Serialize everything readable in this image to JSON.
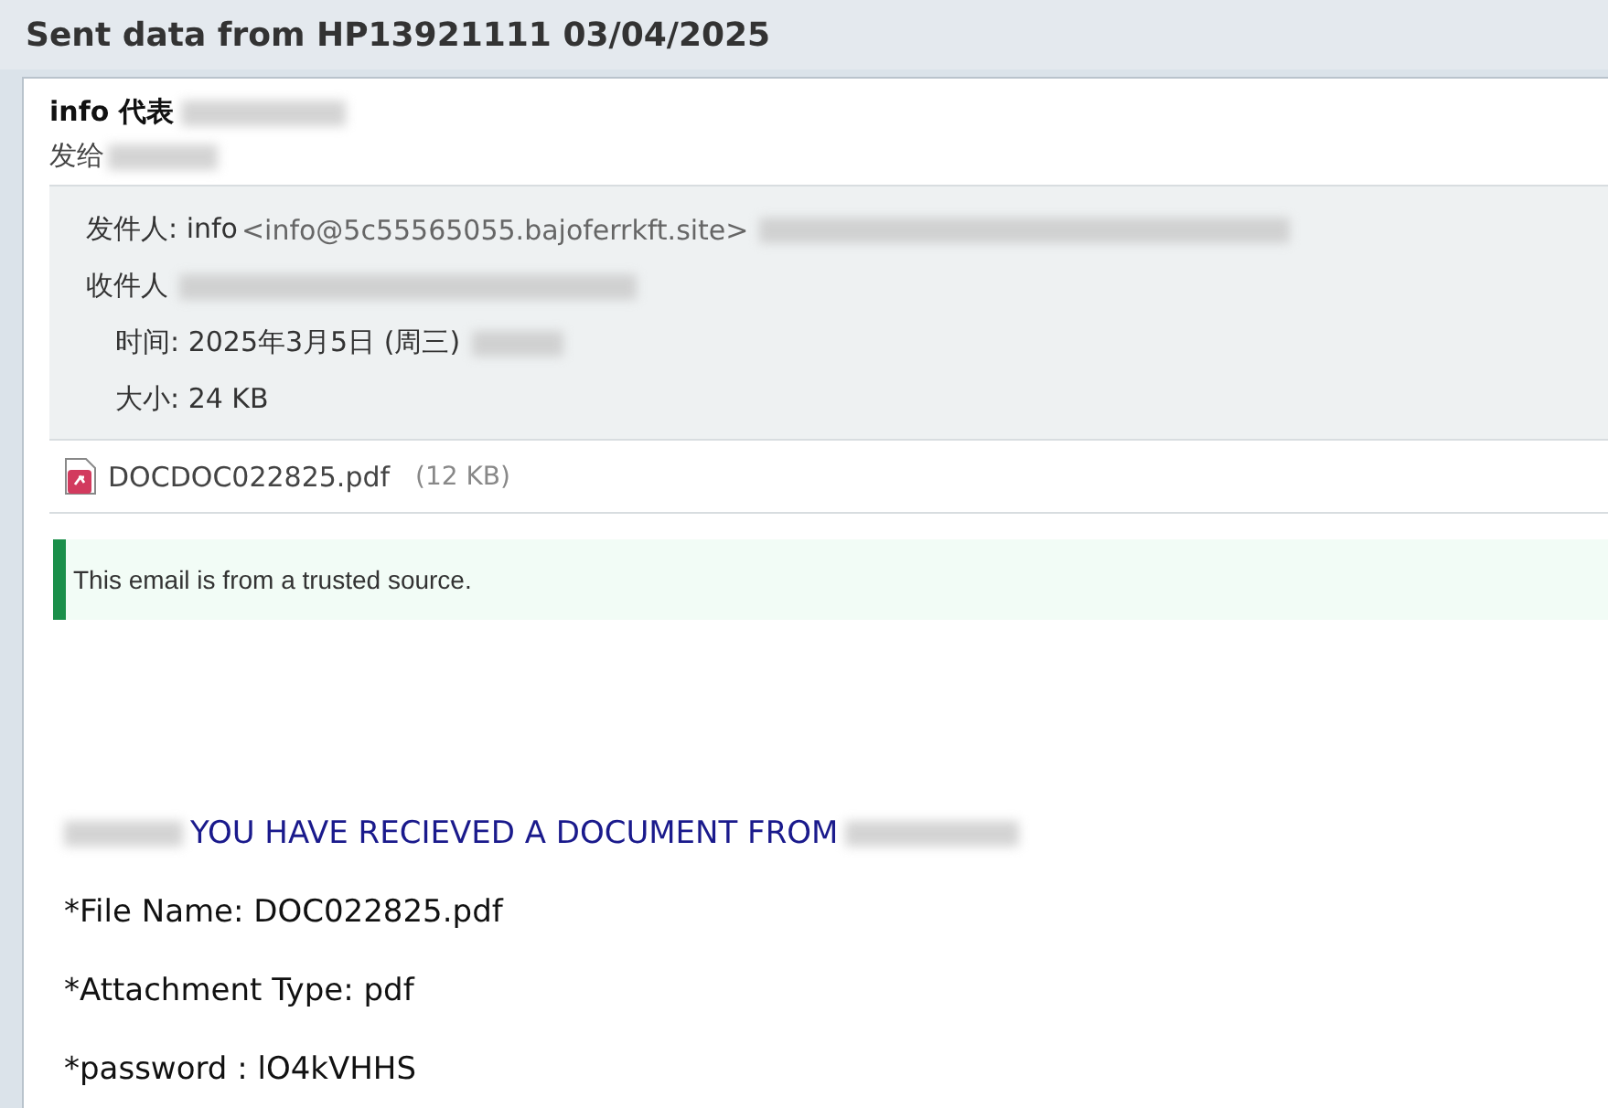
{
  "window": {
    "title": "Sent data from HP13921111 03/04/2025"
  },
  "message": {
    "from_line": "info 代表",
    "to_line": "发给"
  },
  "details": [
    {
      "kind": "sender",
      "label": "发件人:",
      "name": "info",
      "address": "<info@5c55565055.bajoferrkft.site>"
    },
    {
      "kind": "recipient",
      "label": "收件人"
    },
    {
      "kind": "time",
      "label": "时间:",
      "value": "2025年3月5日 (周三)"
    },
    {
      "kind": "size",
      "label": "大小:",
      "value": "24 KB"
    }
  ],
  "attachment": {
    "name": "DOCDOC022825.pdf",
    "size": "(12 KB)"
  },
  "banner": {
    "text": "This email is from a trusted source."
  },
  "body": [
    {
      "kind": "heading",
      "text": "YOU HAVE RECIEVED A DOCUMENT FROM"
    },
    {
      "kind": "line",
      "text": "*File Name: DOC022825.pdf"
    },
    {
      "kind": "line",
      "text": "*Attachment Type: pdf"
    },
    {
      "kind": "line",
      "text": "*password : lO4kVHHS"
    }
  ]
}
